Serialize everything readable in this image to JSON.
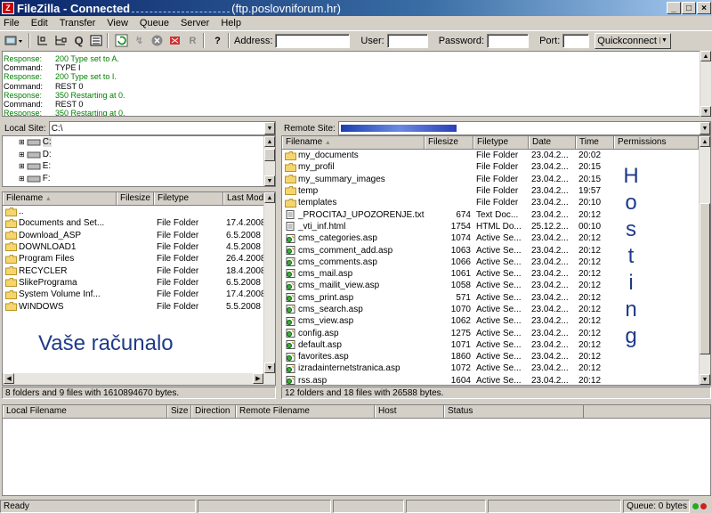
{
  "window": {
    "app_name": "FileZilla",
    "title_prefix": "FileZilla - Connected",
    "title_host": "(ftp.poslovniforum.hr)"
  },
  "menu": [
    "File",
    "Edit",
    "Transfer",
    "View",
    "Queue",
    "Server",
    "Help"
  ],
  "toolbar": {
    "address_label": "Address:",
    "user_label": "User:",
    "password_label": "Password:",
    "port_label": "Port:",
    "quickconnect_label": "Quickconnect",
    "address_value": "",
    "user_value": "",
    "password_value": "",
    "port_value": ""
  },
  "log": [
    {
      "kind": "Response:",
      "msg": "200 Type set to A."
    },
    {
      "kind": "Command:",
      "msg": "TYPE I"
    },
    {
      "kind": "Response:",
      "msg": "200 Type set to I."
    },
    {
      "kind": "Command:",
      "msg": "REST 0"
    },
    {
      "kind": "Response:",
      "msg": "350 Restarting at 0."
    },
    {
      "kind": "Command:",
      "msg": "REST 0"
    },
    {
      "kind": "Response:",
      "msg": "350 Restarting at 0."
    }
  ],
  "local": {
    "site_label": "Local Site:",
    "site_value": "C:\\",
    "tree": [
      "C:",
      "D:",
      "E:",
      "F:"
    ],
    "columns": [
      "Filename",
      "Filesize",
      "Filetype",
      "Last Modi"
    ],
    "files": [
      {
        "name": "..",
        "size": "",
        "type": "",
        "date": ""
      },
      {
        "name": "Documents and Set...",
        "size": "",
        "type": "File Folder",
        "date": "17.4.2008"
      },
      {
        "name": "Download_ASP",
        "size": "",
        "type": "File Folder",
        "date": "6.5.2008"
      },
      {
        "name": "DOWNLOAD1",
        "size": "",
        "type": "File Folder",
        "date": "4.5.2008"
      },
      {
        "name": "Program Files",
        "size": "",
        "type": "File Folder",
        "date": "26.4.2008"
      },
      {
        "name": "RECYCLER",
        "size": "",
        "type": "File Folder",
        "date": "18.4.2008"
      },
      {
        "name": "SlikePrograma",
        "size": "",
        "type": "File Folder",
        "date": "6.5.2008"
      },
      {
        "name": "System Volume Inf...",
        "size": "",
        "type": "File Folder",
        "date": "17.4.2008"
      },
      {
        "name": "WINDOWS",
        "size": "",
        "type": "File Folder",
        "date": "5.5.2008"
      }
    ],
    "overlay": "Vaše računalo",
    "status": "8 folders and 9 files with 1610894670 bytes."
  },
  "remote": {
    "site_label": "Remote Site:",
    "columns": [
      "Filename",
      "Filesize",
      "Filetype",
      "Date",
      "Time",
      "Permissions"
    ],
    "files": [
      {
        "name": "my_documents",
        "size": "",
        "type": "File Folder",
        "date": "23.04.2...",
        "time": "20:02",
        "icon": "folder"
      },
      {
        "name": "my_profil",
        "size": "",
        "type": "File Folder",
        "date": "23.04.2...",
        "time": "20:15",
        "icon": "folder"
      },
      {
        "name": "my_summary_images",
        "size": "",
        "type": "File Folder",
        "date": "23.04.2...",
        "time": "20:15",
        "icon": "folder"
      },
      {
        "name": "temp",
        "size": "",
        "type": "File Folder",
        "date": "23.04.2...",
        "time": "19:57",
        "icon": "folder"
      },
      {
        "name": "templates",
        "size": "",
        "type": "File Folder",
        "date": "23.04.2...",
        "time": "20:10",
        "icon": "folder"
      },
      {
        "name": "_PROCITAJ_UPOZORENJE.txt",
        "size": "674",
        "type": "Text Doc...",
        "date": "23.04.2...",
        "time": "20:12",
        "icon": "text"
      },
      {
        "name": "_vti_inf.html",
        "size": "1754",
        "type": "HTML Do...",
        "date": "25.12.2...",
        "time": "00:10",
        "icon": "text"
      },
      {
        "name": "cms_categories.asp",
        "size": "1074",
        "type": "Active Se...",
        "date": "23.04.2...",
        "time": "20:12",
        "icon": "asp"
      },
      {
        "name": "cms_comment_add.asp",
        "size": "1063",
        "type": "Active Se...",
        "date": "23.04.2...",
        "time": "20:12",
        "icon": "asp"
      },
      {
        "name": "cms_comments.asp",
        "size": "1066",
        "type": "Active Se...",
        "date": "23.04.2...",
        "time": "20:12",
        "icon": "asp"
      },
      {
        "name": "cms_mail.asp",
        "size": "1061",
        "type": "Active Se...",
        "date": "23.04.2...",
        "time": "20:12",
        "icon": "asp"
      },
      {
        "name": "cms_mailit_view.asp",
        "size": "1058",
        "type": "Active Se...",
        "date": "23.04.2...",
        "time": "20:12",
        "icon": "asp"
      },
      {
        "name": "cms_print.asp",
        "size": "571",
        "type": "Active Se...",
        "date": "23.04.2...",
        "time": "20:12",
        "icon": "asp"
      },
      {
        "name": "cms_search.asp",
        "size": "1070",
        "type": "Active Se...",
        "date": "23.04.2...",
        "time": "20:12",
        "icon": "asp"
      },
      {
        "name": "cms_view.asp",
        "size": "1062",
        "type": "Active Se...",
        "date": "23.04.2...",
        "time": "20:12",
        "icon": "asp"
      },
      {
        "name": "config.asp",
        "size": "1275",
        "type": "Active Se...",
        "date": "23.04.2...",
        "time": "20:12",
        "icon": "asp"
      },
      {
        "name": "default.asp",
        "size": "1071",
        "type": "Active Se...",
        "date": "23.04.2...",
        "time": "20:12",
        "icon": "asp"
      },
      {
        "name": "favorites.asp",
        "size": "1860",
        "type": "Active Se...",
        "date": "23.04.2...",
        "time": "20:12",
        "icon": "asp"
      },
      {
        "name": "izradainternetstranica.asp",
        "size": "1072",
        "type": "Active Se...",
        "date": "23.04.2...",
        "time": "20:12",
        "icon": "asp"
      },
      {
        "name": "rss.asp",
        "size": "1604",
        "type": "Active Se...",
        "date": "23.04.2...",
        "time": "20:12",
        "icon": "asp"
      }
    ],
    "overlay_letters": [
      "H",
      "o",
      "s",
      "t",
      "i",
      "n",
      "g"
    ],
    "status": "12 folders and 18 files with 26588 bytes."
  },
  "queue": {
    "columns": [
      "Local Filename",
      "Size",
      "Direction",
      "Remote Filename",
      "Host",
      "Status"
    ]
  },
  "statusbar": {
    "left": "Ready",
    "queue": "Queue: 0 bytes"
  },
  "colors": {
    "title_start": "#0a246a",
    "title_end": "#a6caf0",
    "response_text": "#008000",
    "overlay_text": "#1f3a8a"
  }
}
